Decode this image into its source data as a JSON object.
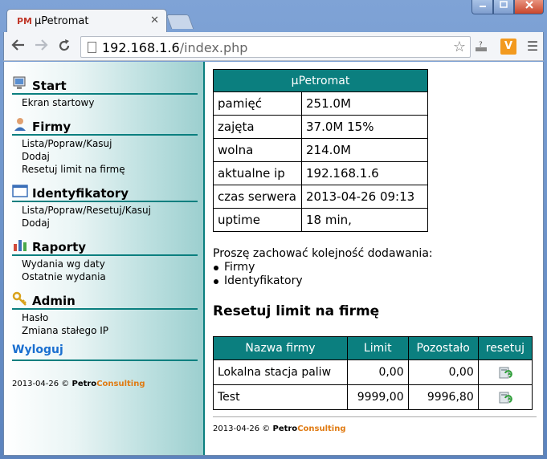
{
  "browser": {
    "tab_title": "µPetromat",
    "tab_favicon": "PM",
    "tab_close": "✕",
    "url_host": "192.168.1.6",
    "url_path": "/index.php"
  },
  "sidebar": {
    "sections": [
      {
        "title": "Start",
        "links": [
          "Ekran startowy"
        ]
      },
      {
        "title": "Firmy",
        "links": [
          "Lista/Popraw/Kasuj",
          "Dodaj",
          "Resetuj limit na firmę"
        ]
      },
      {
        "title": "Identyfikatory",
        "links": [
          "Lista/Popraw/Resetuj/Kasuj",
          "Dodaj"
        ]
      },
      {
        "title": "Raporty",
        "links": [
          "Wydania wg daty",
          "Ostatnie wydania"
        ]
      },
      {
        "title": "Admin",
        "links": [
          "Hasło",
          "Zmiana stałego IP"
        ]
      }
    ],
    "logout": "Wyloguj",
    "footer_date": "2013-04-26 ©",
    "brand_a": "Petro",
    "brand_b": "Consulting"
  },
  "info": {
    "title": "µPetromat",
    "rows": [
      {
        "key": "pamięć",
        "value": "251.0M"
      },
      {
        "key": "zajęta",
        "value": "37.0M 15%"
      },
      {
        "key": "wolna",
        "value": "214.0M"
      },
      {
        "key": "aktualne ip",
        "value": "192.168.1.6"
      },
      {
        "key": "czas serwera",
        "value": "2013-04-26 09:13"
      },
      {
        "key": "uptime",
        "value": "18 min,"
      }
    ]
  },
  "note": {
    "text": "Proszę zachować kolejność dodawania:",
    "items": [
      "Firmy",
      "Identyfikatory"
    ]
  },
  "limits": {
    "heading": "Resetuj limit na firmę",
    "columns": [
      "Nazwa firmy",
      "Limit",
      "Pozostało",
      "resetuj"
    ],
    "rows": [
      {
        "name": "Lokalna stacja paliw",
        "limit": "0,00",
        "left": "0,00"
      },
      {
        "name": "Test",
        "limit": "9999,00",
        "left": "9996,80"
      }
    ]
  },
  "footer": {
    "date": "2013-04-26 ©",
    "brand_a": "Petro",
    "brand_b": "Consulting"
  },
  "colors": {
    "accent": "#0b7f7f",
    "brand_orange": "#e07b13",
    "link": "#1a6fd0"
  }
}
